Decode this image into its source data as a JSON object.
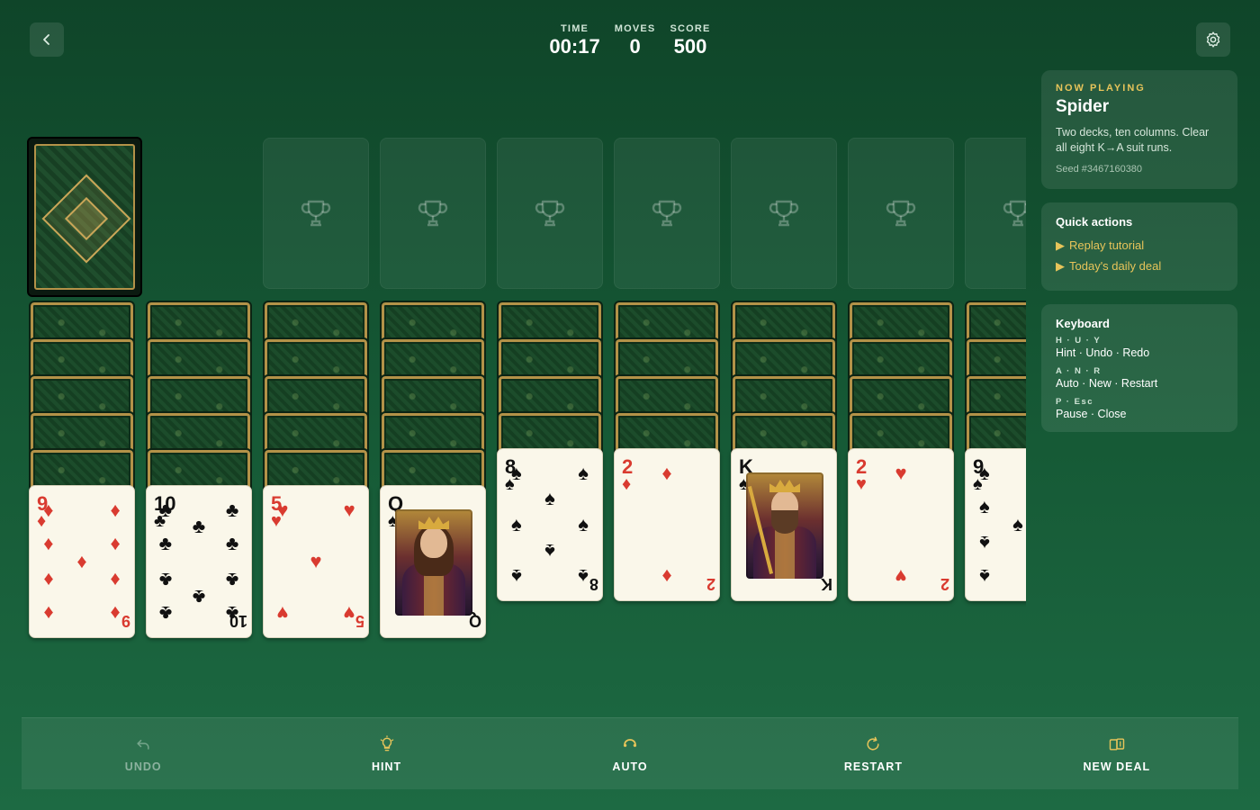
{
  "header": {
    "stats": [
      {
        "label": "TIME",
        "value": "00:17"
      },
      {
        "label": "MOVES",
        "value": "0"
      },
      {
        "label": "SCORE",
        "value": "500"
      }
    ]
  },
  "colors": {
    "accent": "#e7c45a",
    "felt": "#165a36",
    "red_suit": "#d93b30"
  },
  "tableau": [
    {
      "rank": "9",
      "suit": "♦",
      "color": "red"
    },
    {
      "rank": "10",
      "suit": "♣",
      "color": "black"
    },
    {
      "rank": "5",
      "suit": "♥",
      "color": "red"
    },
    {
      "rank": "Q",
      "suit": "♠",
      "color": "black",
      "face": "queen"
    },
    {
      "rank": "8",
      "suit": "♠",
      "color": "black"
    },
    {
      "rank": "2",
      "suit": "♦",
      "color": "red"
    },
    {
      "rank": "K",
      "suit": "♠",
      "color": "black",
      "face": "king"
    },
    {
      "rank": "2",
      "suit": "♥",
      "color": "red"
    },
    {
      "rank": "9",
      "suit": "♠",
      "color": "black"
    }
  ],
  "sidebar": {
    "now_playing": {
      "label": "NOW PLAYING",
      "title": "Spider",
      "description": "Two decks, ten columns. Clear all eight K→A suit runs.",
      "seed": "Seed #3467160380"
    },
    "quick_actions": {
      "title": "Quick actions",
      "items": [
        "Replay tutorial",
        "Today's daily deal"
      ]
    },
    "keyboard": {
      "title": "Keyboard",
      "groups": [
        {
          "keys": "H · U · Y",
          "desc": "Hint · Undo · Redo"
        },
        {
          "keys": "A · N · R",
          "desc": "Auto · New · Restart"
        },
        {
          "keys": "P · Esc",
          "desc": "Pause · Close"
        }
      ]
    }
  },
  "toolbar": {
    "undo": "UNDO",
    "hint": "HINT",
    "auto": "AUTO",
    "restart": "RESTART",
    "new_deal": "NEW DEAL"
  }
}
